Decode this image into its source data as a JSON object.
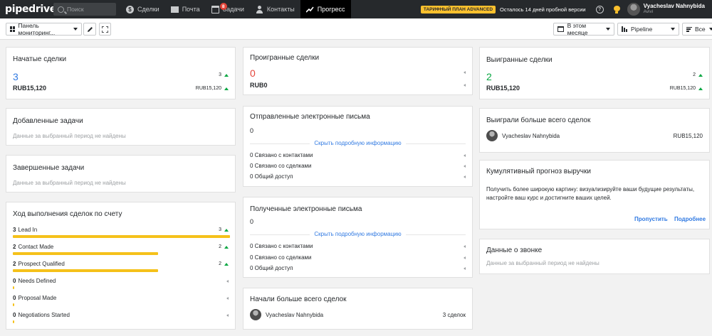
{
  "nav": {
    "logo": "pipedrive",
    "search_placeholder": "Поиск",
    "items": [
      {
        "label": "Сделки",
        "icon": "deals-icon"
      },
      {
        "label": "Почта",
        "icon": "mail-icon"
      },
      {
        "label": "Задачи",
        "icon": "tasks-icon",
        "badge": "8"
      },
      {
        "label": "Контакты",
        "icon": "contacts-icon"
      },
      {
        "label": "Прогресс",
        "icon": "progress-icon",
        "active": true
      }
    ],
    "plan_badge": "ТАРИФНЫЙ ПЛАН ADVANCED",
    "trial": "Осталось 14 дней пробной версии",
    "help": "?",
    "user_name": "Vyacheslav Nahnybida",
    "company": "Avivi"
  },
  "toolbar": {
    "dashboard": "Панель мониторинг...",
    "period": "В этом месяце",
    "pipeline": "Pipeline",
    "filter": "Все"
  },
  "cards": {
    "started": {
      "title": "Начатые сделки",
      "count": "3",
      "money": "RUB15,120",
      "delta_count": "3",
      "delta_money": "RUB15,120"
    },
    "added_tasks": {
      "title": "Добавленные задачи",
      "empty": "Данные за выбранный период не найдены"
    },
    "done_tasks": {
      "title": "Завершенные задачи",
      "empty": "Данные за выбранный период не найдены"
    },
    "progress": {
      "title": "Ход выполнения сделок по счету",
      "stages": [
        {
          "count": "3",
          "name": "Lead In",
          "delta": "3",
          "trend": "up",
          "fill": 1.0
        },
        {
          "count": "2",
          "name": "Contact Made",
          "delta": "2",
          "trend": "up",
          "fill": 0.67
        },
        {
          "count": "2",
          "name": "Prospect Qualified",
          "delta": "2",
          "trend": "up",
          "fill": 0.67
        },
        {
          "count": "0",
          "name": "Needs Defined",
          "delta": "",
          "trend": "none",
          "fill": 0
        },
        {
          "count": "0",
          "name": "Proposal Made",
          "delta": "",
          "trend": "none",
          "fill": 0
        },
        {
          "count": "0",
          "name": "Negotiations Started",
          "delta": "",
          "trend": "none",
          "fill": 0
        }
      ]
    },
    "lost": {
      "title": "Проигранные сделки",
      "count": "0",
      "money": "RUB0"
    },
    "sent": {
      "title": "Отправленные электронные письма",
      "count": "0",
      "link": "Скрыть подробную информацию",
      "rows": [
        "0 Связано с контактами",
        "0 Связано со сделками",
        "0 Общий доступ"
      ]
    },
    "received": {
      "title": "Полученные электронные письма",
      "count": "0",
      "link": "Скрыть подробную информацию",
      "rows": [
        "0 Связано с контактами",
        "0 Связано со сделками",
        "0 Общий доступ"
      ]
    },
    "most_started": {
      "title": "Начали больше всего сделок",
      "person": "Vyacheslav Nahnybida",
      "value": "3 сделок"
    },
    "won": {
      "title": "Выигранные сделки",
      "count": "2",
      "money": "RUB15,120",
      "delta_count": "2",
      "delta_money": "RUB15,120"
    },
    "most_won": {
      "title": "Выиграли больше всего сделок",
      "person": "Vyacheslav Nahnybida",
      "value": "RUB15,120"
    },
    "forecast": {
      "title": "Кумулятивный прогноз выручки",
      "text": "Получить более широкую картину: визуализируйте ваши будущие результаты, настройте ваш курс и достигните ваших целей.",
      "skip": "Пропустить",
      "more": "Подробнее"
    },
    "calls": {
      "title": "Данные о звонке",
      "empty": "Данные за выбранный период не найдены"
    }
  },
  "colors": {
    "accent": "#317ae2",
    "positive": "#08a742",
    "negative": "#e4453a",
    "bar": "#f5c11a",
    "nav": "#26292c"
  }
}
